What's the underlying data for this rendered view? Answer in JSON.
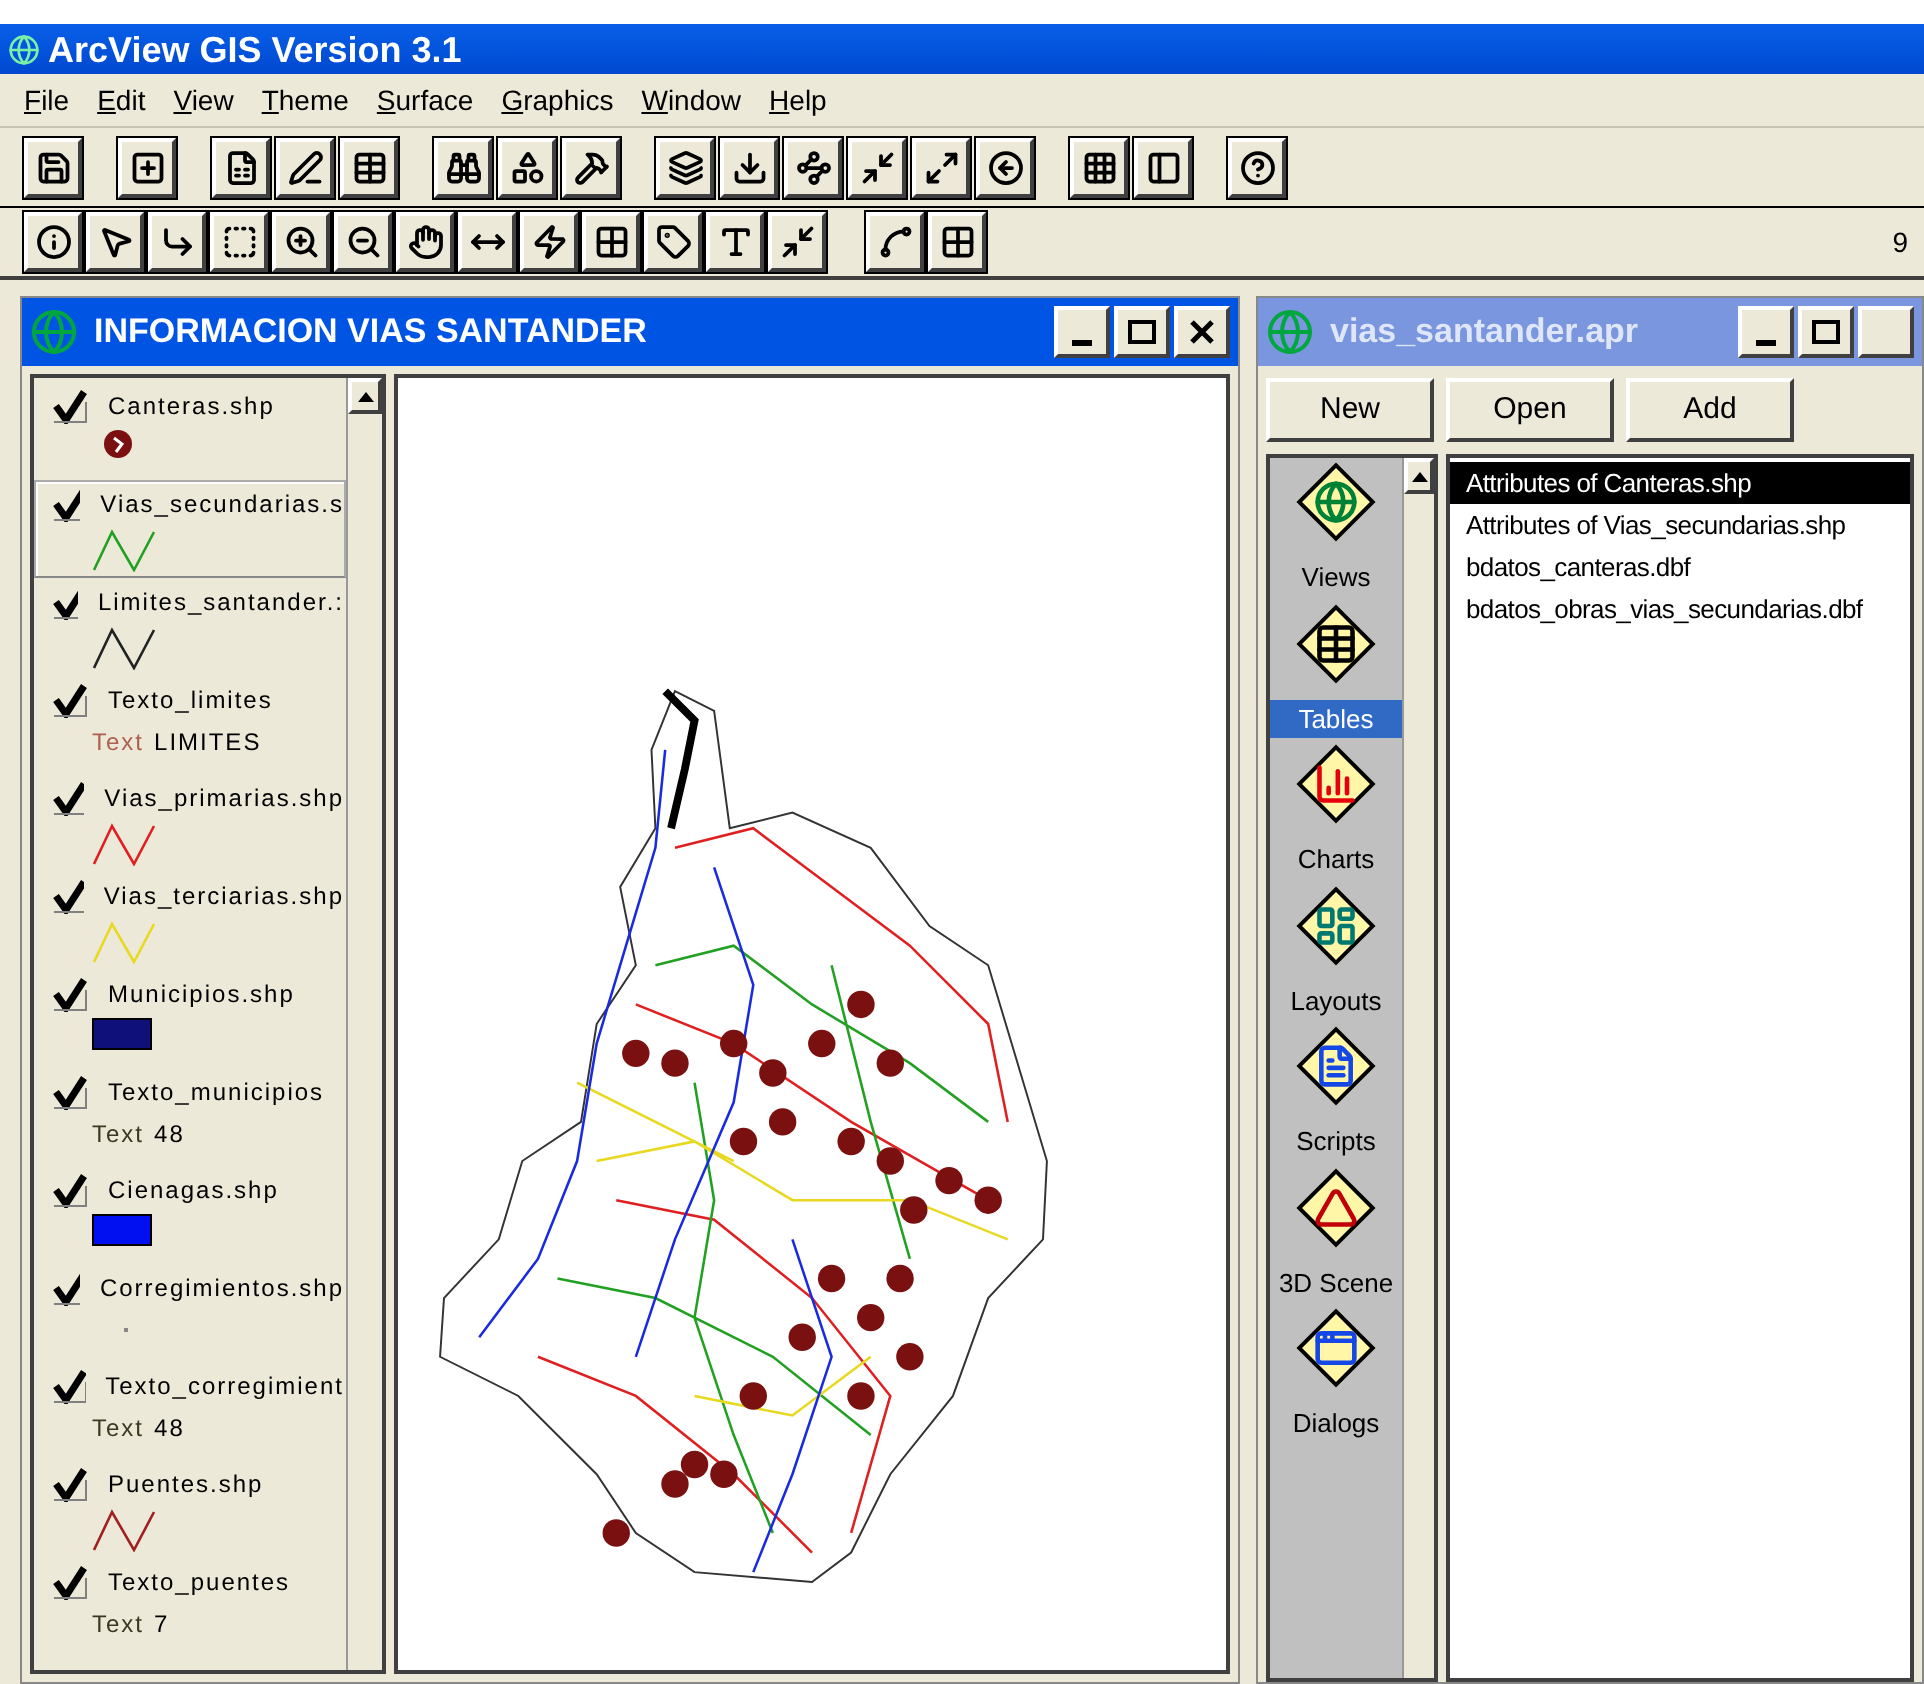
{
  "app": {
    "title": "ArcView GIS Version 3.1"
  },
  "menu": [
    {
      "label": "File"
    },
    {
      "label": "Edit"
    },
    {
      "label": "View"
    },
    {
      "label": "Theme"
    },
    {
      "label": "Surface"
    },
    {
      "label": "Graphics"
    },
    {
      "label": "Window"
    },
    {
      "label": "Help"
    }
  ],
  "status_text": "9",
  "view_window": {
    "title": "INFORMACION VIAS SANTANDER",
    "active": true,
    "legend": [
      {
        "name": "Canteras.shp",
        "checked": true,
        "selected": false,
        "kind": "marker",
        "color": "#7a1010"
      },
      {
        "name": "Vias_secundarias.s",
        "checked": true,
        "selected": true,
        "kind": "line",
        "color": "#22a022"
      },
      {
        "name": "Limites_santander.:",
        "checked": true,
        "selected": false,
        "kind": "line",
        "color": "#222222"
      },
      {
        "name": "Texto_limites",
        "checked": true,
        "selected": false,
        "kind": "text",
        "label": "Text",
        "color": "#b06050",
        "sample": "LIMITES"
      },
      {
        "name": "Vias_primarias.shp",
        "checked": true,
        "selected": false,
        "kind": "line",
        "color": "#e02020"
      },
      {
        "name": "Vias_terciarias.shp",
        "checked": true,
        "selected": false,
        "kind": "line",
        "color": "#e8d820"
      },
      {
        "name": "Municipios.shp",
        "checked": true,
        "selected": false,
        "kind": "fill",
        "color": "#10107a"
      },
      {
        "name": "Texto_municipios",
        "checked": true,
        "selected": false,
        "kind": "text",
        "label": "Text",
        "color": "#3a3a20",
        "sample": "48"
      },
      {
        "name": "Cienagas.shp",
        "checked": true,
        "selected": false,
        "kind": "fill",
        "color": "#0010f0"
      },
      {
        "name": "Corregimientos.shp",
        "checked": true,
        "selected": false,
        "kind": "dot",
        "color": "#888888"
      },
      {
        "name": "Texto_corregimient",
        "checked": true,
        "selected": false,
        "kind": "text",
        "label": "Text",
        "color": "#3a3a20",
        "sample": "48"
      },
      {
        "name": "Puentes.shp",
        "checked": true,
        "selected": false,
        "kind": "line",
        "color": "#a02020"
      },
      {
        "name": "Texto_puentes",
        "checked": true,
        "selected": false,
        "kind": "text",
        "label": "Text",
        "color": "#3a3a20",
        "sample": "7"
      }
    ]
  },
  "project_window": {
    "title": "vias_santander.apr",
    "active": false,
    "buttons": [
      "New",
      "Open",
      "Add"
    ],
    "doc_types": [
      {
        "label": "Views",
        "kind": "views",
        "selected": false
      },
      {
        "label": "Tables",
        "kind": "tables",
        "selected": true
      },
      {
        "label": "Charts",
        "kind": "charts",
        "selected": false
      },
      {
        "label": "Layouts",
        "kind": "layouts",
        "selected": false
      },
      {
        "label": "Scripts",
        "kind": "scripts",
        "selected": false
      },
      {
        "label": "3D Scene",
        "kind": "scenes",
        "selected": false
      },
      {
        "label": "Dialogs",
        "kind": "dialogs",
        "selected": false
      }
    ],
    "documents": [
      {
        "label": "Attributes of Canteras.shp",
        "selected": true
      },
      {
        "label": "Attributes of Vias_secundarias.shp",
        "selected": false
      },
      {
        "label": "bdatos_canteras.dbf",
        "selected": false
      },
      {
        "label": "bdatos_obras_vias_secundarias.dbf",
        "selected": false
      }
    ]
  }
}
